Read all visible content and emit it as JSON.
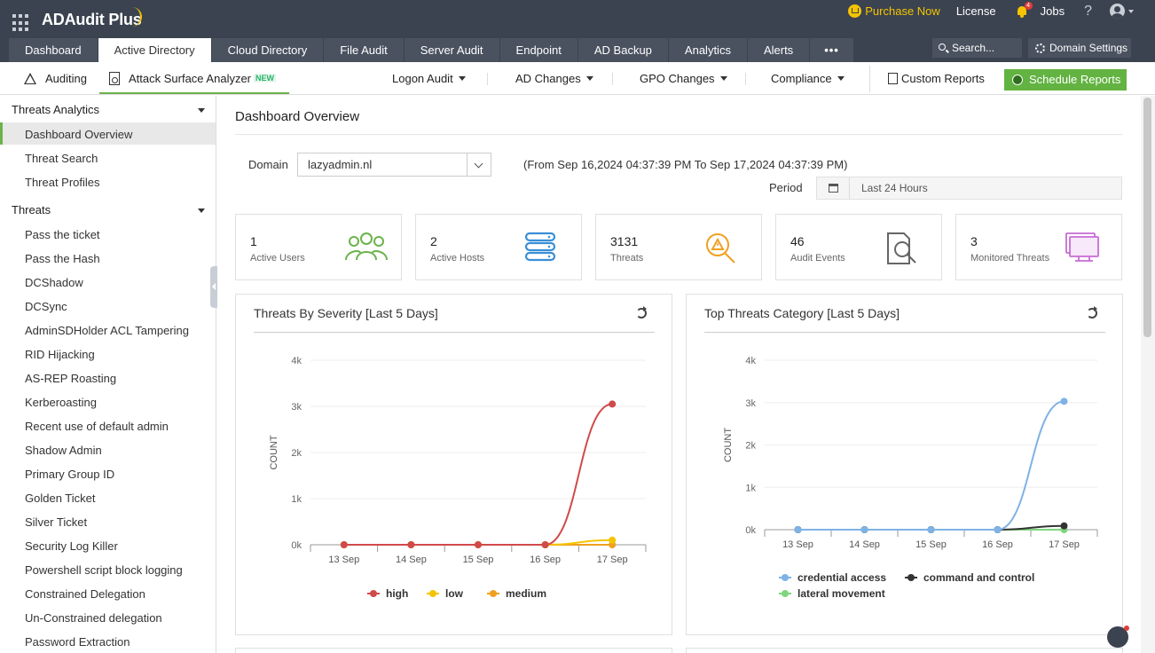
{
  "header": {
    "product": "ADAudit Plus",
    "purchase": "Purchase Now",
    "license": "License",
    "notif_count": "4",
    "jobs": "Jobs",
    "help": "?"
  },
  "tabs": [
    "Dashboard",
    "Active Directory",
    "Cloud Directory",
    "File Audit",
    "Server Audit",
    "Endpoint",
    "AD Backup",
    "Analytics",
    "Alerts"
  ],
  "tab_more": "•••",
  "search": {
    "placeholder": "Search..."
  },
  "domain_settings": "Domain Settings",
  "subnav": {
    "auditing": "Auditing",
    "attack_surface": "Attack Surface Analyzer",
    "new_badge": "NEW",
    "logon_audit": "Logon Audit",
    "ad_changes": "AD Changes",
    "gpo_changes": "GPO Changes",
    "compliance": "Compliance",
    "custom_reports": "Custom Reports",
    "schedule_reports": "Schedule Reports"
  },
  "sidebar": {
    "section1": "Threats Analytics",
    "section1_items": [
      "Dashboard Overview",
      "Threat Search",
      "Threat Profiles"
    ],
    "section2": "Threats",
    "section2_items": [
      "Pass the ticket",
      "Pass the Hash",
      "DCShadow",
      "DCSync",
      "AdminSDHolder ACL Tampering",
      "RID Hijacking",
      "AS-REP Roasting",
      "Kerberoasting",
      "Recent use of default admin",
      "Shadow Admin",
      "Primary Group ID",
      "Golden Ticket",
      "Silver Ticket",
      "Security Log Killer",
      "Powershell script block logging",
      "Constrained Delegation",
      "Un-Constrained delegation",
      "Password Extraction"
    ]
  },
  "main": {
    "title": "Dashboard Overview",
    "domain_label": "Domain",
    "domain_value": "lazyadmin.nl",
    "range_text": "(From Sep 16,2024 04:37:39 PM To Sep 17,2024 04:37:39 PM)",
    "period_label": "Period",
    "period_value": "Last 24 Hours"
  },
  "stats": [
    {
      "value": "1",
      "label": "Active Users",
      "icon": "users-icon"
    },
    {
      "value": "2",
      "label": "Active Hosts",
      "icon": "servers-icon"
    },
    {
      "value": "3131",
      "label": "Threats",
      "icon": "threat-search-icon"
    },
    {
      "value": "46",
      "label": "Audit Events",
      "icon": "audit-doc-icon"
    },
    {
      "value": "3",
      "label": "Monitored Threats",
      "icon": "monitor-icon"
    }
  ],
  "colors": {
    "high": "#d04a4a",
    "low": "#f5c400",
    "medium": "#f0a020",
    "credential_access": "#7fb2e5",
    "command_and_control": "#333333",
    "lateral_movement": "#7ed67e"
  },
  "chart_data": [
    {
      "type": "line",
      "title": "Threats By Severity [Last 5 Days]",
      "ylabel": "COUNT",
      "categories": [
        "13 Sep",
        "14 Sep",
        "15 Sep",
        "16 Sep",
        "17 Sep"
      ],
      "yticks": [
        "0k",
        "1k",
        "2k",
        "3k",
        "4k"
      ],
      "ylim": [
        0,
        4000
      ],
      "series": [
        {
          "name": "high",
          "values": [
            0,
            0,
            0,
            0,
            3050
          ]
        },
        {
          "name": "low",
          "values": [
            0,
            0,
            0,
            0,
            100
          ]
        },
        {
          "name": "medium",
          "values": [
            0,
            0,
            0,
            0,
            0
          ]
        }
      ]
    },
    {
      "type": "line",
      "title": "Top Threats Category [Last 5 Days]",
      "ylabel": "COUNT",
      "categories": [
        "13 Sep",
        "14 Sep",
        "15 Sep",
        "16 Sep",
        "17 Sep"
      ],
      "yticks": [
        "0k",
        "1k",
        "2k",
        "3k",
        "4k"
      ],
      "ylim": [
        0,
        4000
      ],
      "series": [
        {
          "name": "credential access",
          "values": [
            0,
            0,
            0,
            0,
            3030
          ]
        },
        {
          "name": "command and control",
          "values": [
            0,
            0,
            0,
            0,
            90
          ]
        },
        {
          "name": "lateral movement",
          "values": [
            0,
            0,
            0,
            0,
            0
          ]
        }
      ]
    }
  ]
}
